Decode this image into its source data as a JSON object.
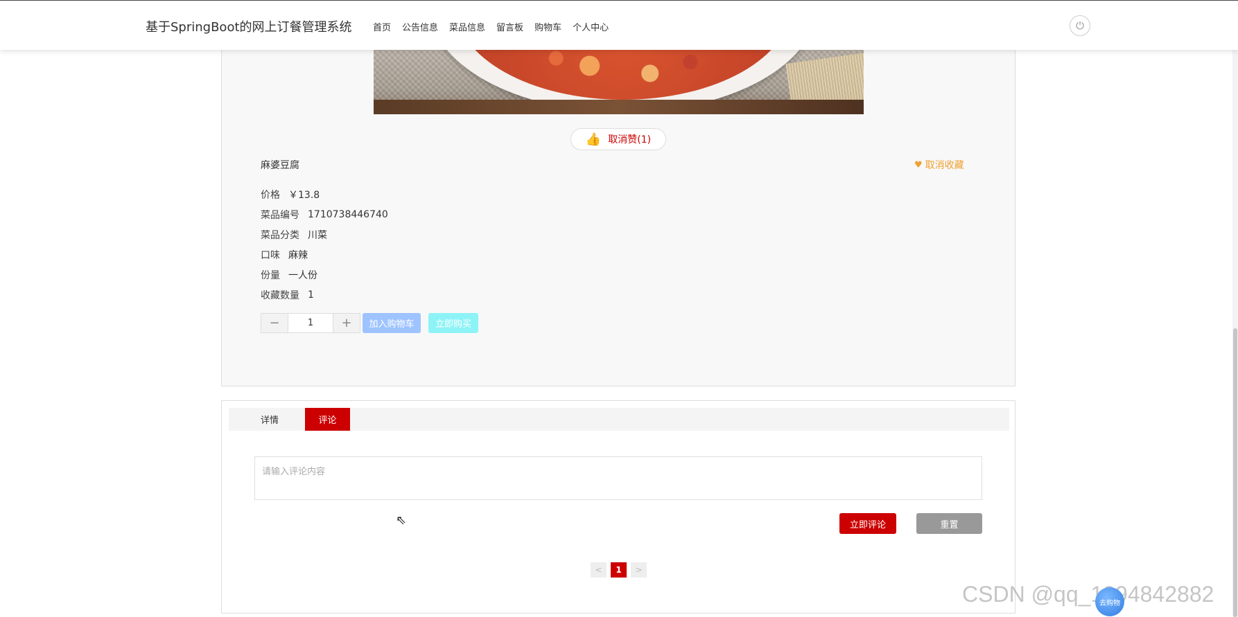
{
  "header": {
    "site_title": "基于SpringBoot的网上订餐管理系统",
    "nav": [
      "首页",
      "公告信息",
      "菜品信息",
      "留言板",
      "购物车",
      "个人中心"
    ],
    "power_icon": "power-icon"
  },
  "product": {
    "like_label": "取消赞(1)",
    "name": "麻婆豆腐",
    "favorite_label": "取消收藏",
    "attrs": [
      {
        "label": "价格",
        "value": "￥13.8"
      },
      {
        "label": "菜品编号",
        "value": "1710738446740"
      },
      {
        "label": "菜品分类",
        "value": "川菜"
      },
      {
        "label": "口味",
        "value": "麻辣"
      },
      {
        "label": "份量",
        "value": "一人份"
      },
      {
        "label": "收藏数量",
        "value": "1"
      }
    ],
    "quantity": "1",
    "add_cart_label": "加入购物车",
    "buy_now_label": "立即购买",
    "colors": {
      "accent": "#cc0000",
      "favorite": "#f0a030",
      "cart": "#9ec3ff",
      "buy": "#8ef3f6"
    }
  },
  "tabs": [
    {
      "label": "详情",
      "active": false
    },
    {
      "label": "评论",
      "active": true
    }
  ],
  "comment": {
    "placeholder": "请输入评论内容",
    "submit_label": "立即评论",
    "reset_label": "重置"
  },
  "pagination": {
    "prev": "<",
    "current": "1",
    "next": ">"
  },
  "watermark": "CSDN @qq_1394842882",
  "float_ball_label": "去购物"
}
